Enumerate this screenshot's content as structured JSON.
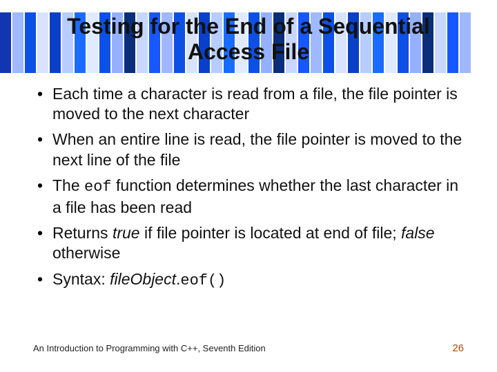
{
  "title_line1": "Testing for the End of a Sequential",
  "title_line2": "Access File",
  "bullets": {
    "b1": "Each time a character is read from a file, the file pointer is moved to the next character",
    "b2": "When an entire line is read, the file pointer is moved to the next line of the file",
    "b3_pre": "The ",
    "b3_code": "eof",
    "b3_post": " function determines whether the last character in a file has been read",
    "b4_pre": "Returns ",
    "b4_true": "true",
    "b4_mid": " if file pointer is located at end of file; ",
    "b4_false": "false",
    "b4_post": " otherwise",
    "b5_pre": "Syntax: ",
    "b5_obj": "fileObject",
    "b5_dot": ".",
    "b5_code": "eof()"
  },
  "footer_book": "An Introduction to Programming with C++, Seventh Edition",
  "footer_page": "26",
  "bars": [
    "#0a2e7a",
    "#c7d7ff",
    "#1036b3",
    "#9fb8ff",
    "#0d50e6",
    "#d9e3ff",
    "#0a40c9",
    "#b7ccff",
    "#1a6bff",
    "#e2eaff",
    "#0d50e6",
    "#94b0ff",
    "#0a2e7a",
    "#c7d7ff",
    "#1657ff",
    "#9fb8ff",
    "#0d50e6",
    "#d9e3ff",
    "#0a40c9",
    "#b7ccff",
    "#1a6bff",
    "#e2eaff",
    "#0d50e6",
    "#94b0ff",
    "#0a2e7a",
    "#c7d7ff",
    "#1657ff",
    "#9fb8ff",
    "#0d50e6",
    "#d9e3ff",
    "#0a40c9",
    "#b7ccff",
    "#1a6bff",
    "#e2eaff",
    "#0d50e6",
    "#94b0ff",
    "#0a2e7a",
    "#c7d7ff",
    "#1657ff",
    "#9fb8ff"
  ]
}
